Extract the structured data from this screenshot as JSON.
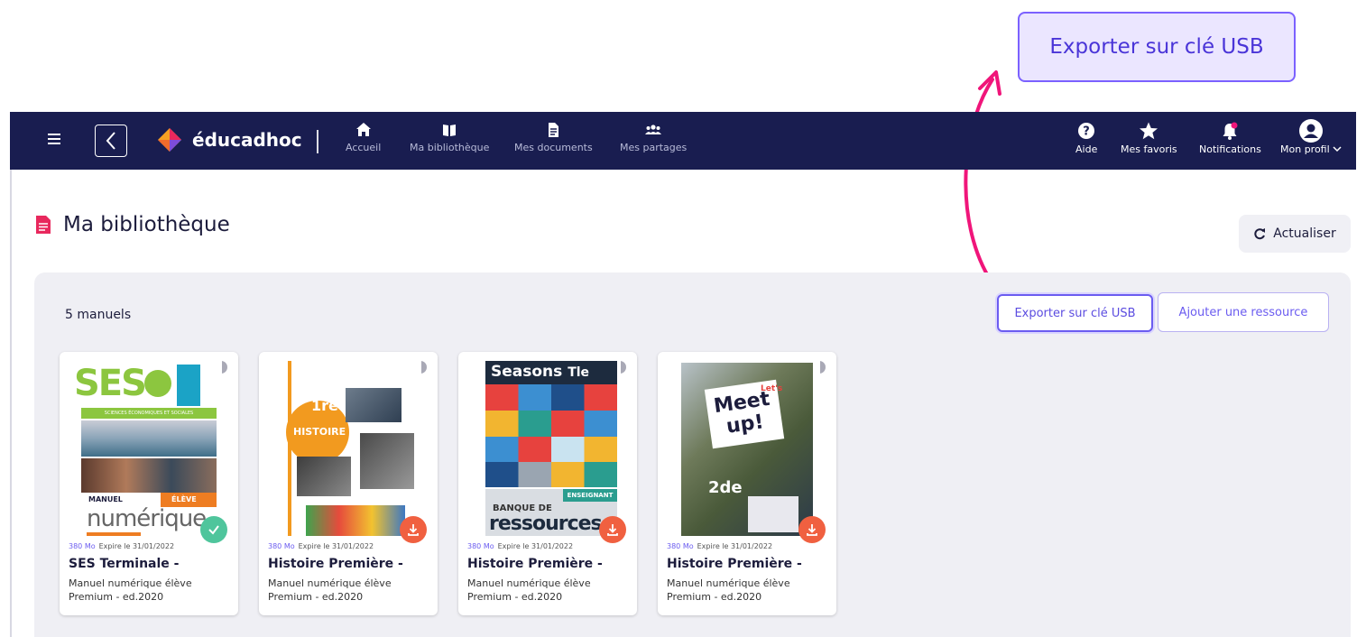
{
  "callout": {
    "label": "Exporter sur clé USB"
  },
  "navbar": {
    "brand": "éducadhoc",
    "items": [
      {
        "label": "Accueil",
        "icon": "home-icon"
      },
      {
        "label": "Ma bibliothèque",
        "icon": "book-icon"
      },
      {
        "label": "Mes documents",
        "icon": "document-icon"
      },
      {
        "label": "Mes partages",
        "icon": "people-icon"
      }
    ],
    "right": {
      "help": "Aide",
      "favorites": "Mes favoris",
      "notifications": "Notifications",
      "profile": "Mon profil"
    }
  },
  "page": {
    "title": "Ma bibliothèque",
    "refresh_label": "Actualiser",
    "count": "5 manuels",
    "export_usb_label": "Exporter sur clé USB",
    "add_resource_label": "Ajouter une ressource"
  },
  "books": [
    {
      "size": "380 Mo",
      "expiry": "Expire le 31/01/2022",
      "title": "SES Terminale -",
      "subtitle": "Manuel numérique élève Premium - ed.2020",
      "status": "downloaded",
      "cover": {
        "big": "SES",
        "band": "SCIENCES ÉCONOMIQUES ET SOCIALES",
        "label1": "MANUEL",
        "label2": "ÉLÈVE",
        "word": "numérique"
      }
    },
    {
      "size": "380 Mo",
      "expiry": "Expire le 31/01/2022",
      "title": "Histoire Première -",
      "subtitle": "Manuel numérique élève Premium - ed.2020",
      "status": "download",
      "cover": {
        "big": "HISTOIRE",
        "grade": "1re"
      }
    },
    {
      "size": "380 Mo",
      "expiry": "Expire le 31/01/2022",
      "title": "Histoire Première -",
      "subtitle": "Manuel numérique élève Premium - ed.2020",
      "status": "download",
      "cover": {
        "big": "Seasons",
        "grade": "Tle",
        "tag": "ENSEIGNANT",
        "line1": "BANQUE DE",
        "line2": "ressources"
      }
    },
    {
      "size": "380 Mo",
      "expiry": "Expire le 31/01/2022",
      "title": "Histoire Première -",
      "subtitle": "Manuel numérique élève Premium - ed.2020",
      "status": "download",
      "cover": {
        "big1": "Meet",
        "big2": "up!",
        "small": "Let's",
        "grade": "2de"
      }
    }
  ],
  "colors": {
    "navbar": "#191d50",
    "accent": "#6b5cf0",
    "callout_arrow": "#f0157a",
    "ok": "#4fc59c",
    "download": "#f06040"
  }
}
